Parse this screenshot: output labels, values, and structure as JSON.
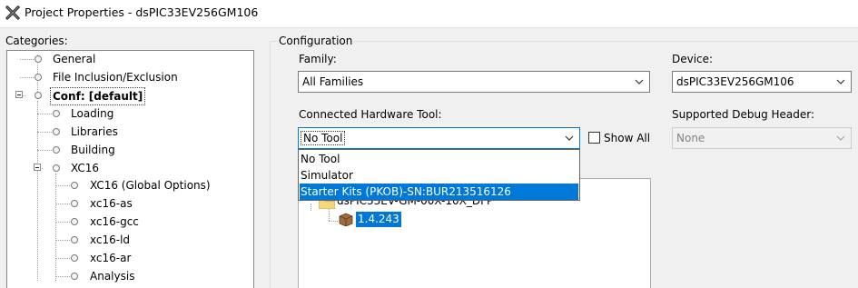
{
  "window": {
    "title": "Project Properties - dsPIC33EV256GM106"
  },
  "categories": {
    "label": "Categories:",
    "items": [
      {
        "label": "General"
      },
      {
        "label": "File Inclusion/Exclusion"
      },
      {
        "label": "Conf: [default]"
      },
      {
        "label": "Loading"
      },
      {
        "label": "Libraries"
      },
      {
        "label": "Building"
      },
      {
        "label": "XC16"
      },
      {
        "label": "XC16 (Global Options)"
      },
      {
        "label": "xc16-as"
      },
      {
        "label": "xc16-gcc"
      },
      {
        "label": "xc16-ld"
      },
      {
        "label": "xc16-ar"
      },
      {
        "label": "Analysis"
      }
    ]
  },
  "configuration": {
    "legend": "Configuration",
    "family_label": "Family:",
    "family_value": "All Families",
    "device_label": "Device:",
    "device_value": "dsPIC33EV256GM106",
    "tool_label": "Connected Hardware Tool:",
    "tool_value": "No Tool",
    "show_all_label": "Show All",
    "debug_header_label": "Supported Debug Header:",
    "debug_header_value": "None",
    "tool_options": [
      "No Tool",
      "Simulator",
      "Starter Kits (PKOB)-SN:BUR213516126"
    ],
    "pack_name": "dsPIC33EV-GM-00X-10X_DFP",
    "pack_version": "1.4.243"
  },
  "colors": {
    "selection": "#0078d7",
    "window_bg": "#f0f0f0"
  }
}
